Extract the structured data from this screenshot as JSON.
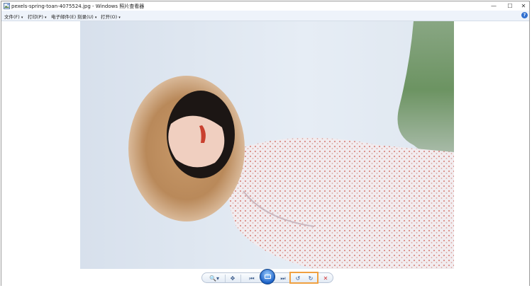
{
  "window": {
    "title": "pexels-spring-toan-4075524.jpg - Windows 照片查看器",
    "controls": {
      "minimize": "—",
      "maximize": "☐",
      "close": "✕"
    }
  },
  "menu": {
    "items": [
      {
        "label": "文件(F)",
        "arrow": "▾"
      },
      {
        "label": "打印(P)",
        "arrow": "▾"
      },
      {
        "label": "电子邮件(E)",
        "arrow": ""
      },
      {
        "label": "刻录(U)",
        "arrow": "▾"
      },
      {
        "label": "打开(O)",
        "arrow": "▾"
      }
    ],
    "help": "?"
  },
  "toolbar": {
    "zoom": "🔍▾",
    "actual_size": "✥",
    "previous": "⏮",
    "next": "⏭",
    "rotate_counterclockwise": "↺",
    "rotate_clockwise": "↻",
    "delete": "✕"
  },
  "colors": {
    "accent_highlight": "#f0a040",
    "delete_red": "#d23030",
    "toolbar_blue": "#1e63c8"
  }
}
